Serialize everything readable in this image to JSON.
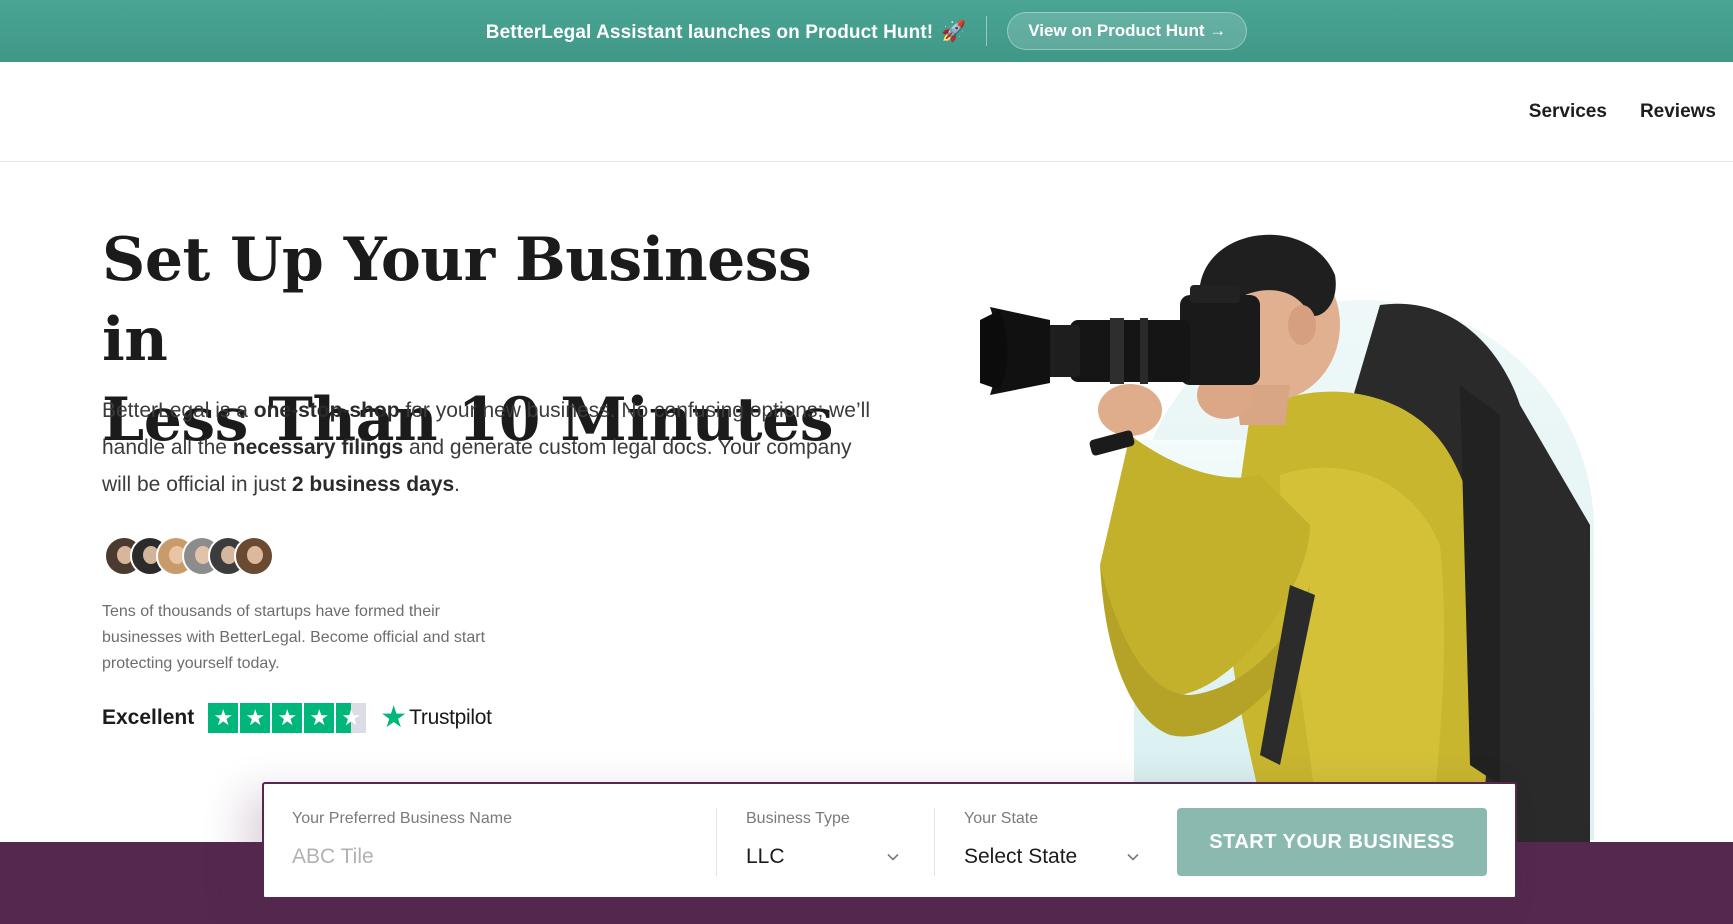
{
  "promo": {
    "text": "BetterLegal Assistant launches on Product Hunt!",
    "rocket_icon": "🚀",
    "button_label": "View on Product Hunt →"
  },
  "nav": {
    "items": [
      "Services",
      "Reviews"
    ]
  },
  "hero": {
    "title_line1": "Set Up Your Business in",
    "title_line2": "Less Than 10 Minutes",
    "desc_1": "BetterLegal is a ",
    "desc_b1": "one-stop-shop",
    "desc_2": " for your new business. No confusing options; we’ll handle all the ",
    "desc_b2": "necessary filings",
    "desc_3": " and generate custom legal docs. Your company will be official in just ",
    "desc_b3": "2 business days",
    "desc_4": ".",
    "social_proof": "Tens of thousands of startups have formed their businesses with BetterLegal. Become official and start protecting yourself today."
  },
  "rating": {
    "label": "Excellent",
    "stars": 4.5,
    "brand": "Trustpilot",
    "star_color": "#00b67a"
  },
  "form": {
    "name_label": "Your Preferred Business Name",
    "name_placeholder": "ABC Tile",
    "type_label": "Business Type",
    "type_value": "LLC",
    "state_label": "Your State",
    "state_value": "Select State",
    "submit_label": "START YOUR BUSINESS"
  },
  "colors": {
    "promo_bg": "#44a090",
    "band": "#55294f",
    "cta": "#8ab9b0"
  }
}
